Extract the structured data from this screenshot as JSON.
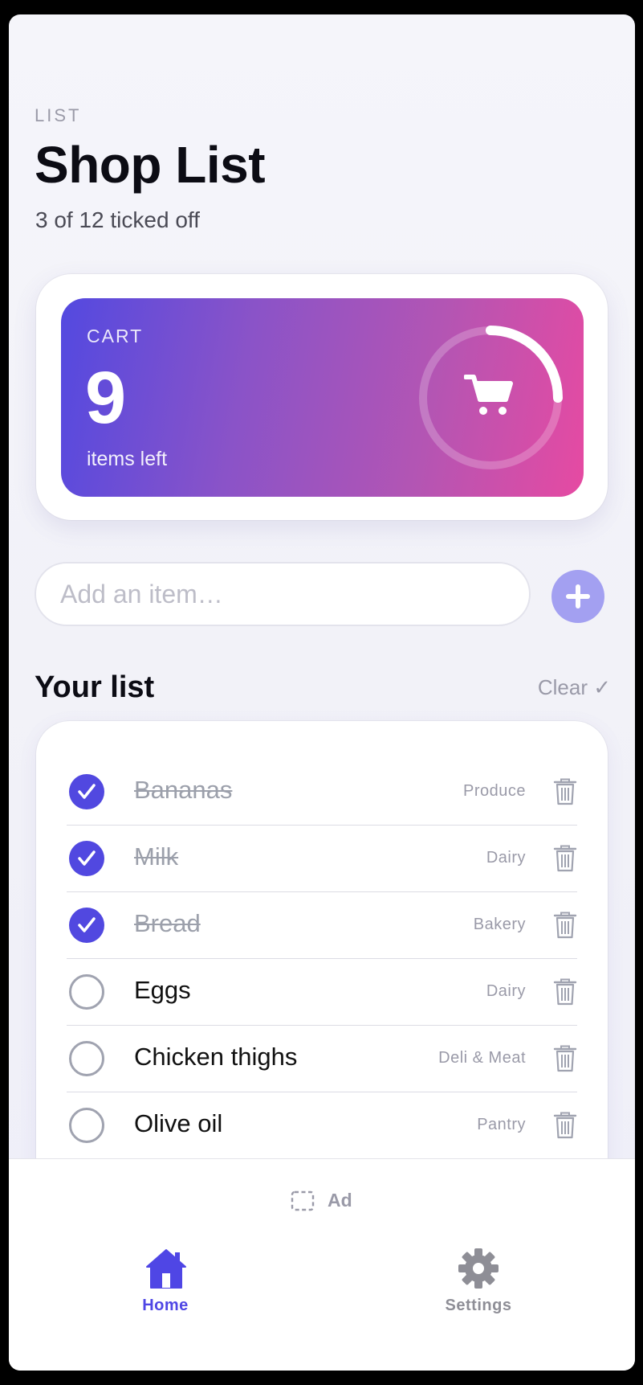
{
  "header": {
    "eyebrow": "LIST",
    "title": "Shop List",
    "subtitle": "3 of 12 ticked off"
  },
  "cart_card": {
    "label": "CART",
    "count": "9",
    "sub": "items left",
    "progress_fraction": 0.25,
    "icon": "cart-icon",
    "gradient_colors": [
      "#5349e0",
      "#e64aa2"
    ]
  },
  "add_item": {
    "placeholder": "Add an item…",
    "value": "",
    "button_icon": "plus-icon"
  },
  "list_section": {
    "title": "Your list",
    "clear_label": "Clear ✓"
  },
  "items": [
    {
      "name": "Bananas",
      "category": "Produce",
      "checked": true
    },
    {
      "name": "Milk",
      "category": "Dairy",
      "checked": true
    },
    {
      "name": "Bread",
      "category": "Bakery",
      "checked": true
    },
    {
      "name": "Eggs",
      "category": "Dairy",
      "checked": false
    },
    {
      "name": "Chicken thighs",
      "category": "Deli & Meat",
      "checked": false
    },
    {
      "name": "Olive oil",
      "category": "Pantry",
      "checked": false
    }
  ],
  "ad_banner": {
    "label": "Ad",
    "icon": "ad-placeholder-icon"
  },
  "tabs": [
    {
      "label": "Home",
      "icon": "home-icon",
      "active": true
    },
    {
      "label": "Settings",
      "icon": "gear-icon",
      "active": false
    }
  ],
  "colors": {
    "accent": "#4f46e5",
    "checked_fill": "#5148e0",
    "muted_text": "#9a9aa8",
    "add_button": "#a3a0f1"
  }
}
